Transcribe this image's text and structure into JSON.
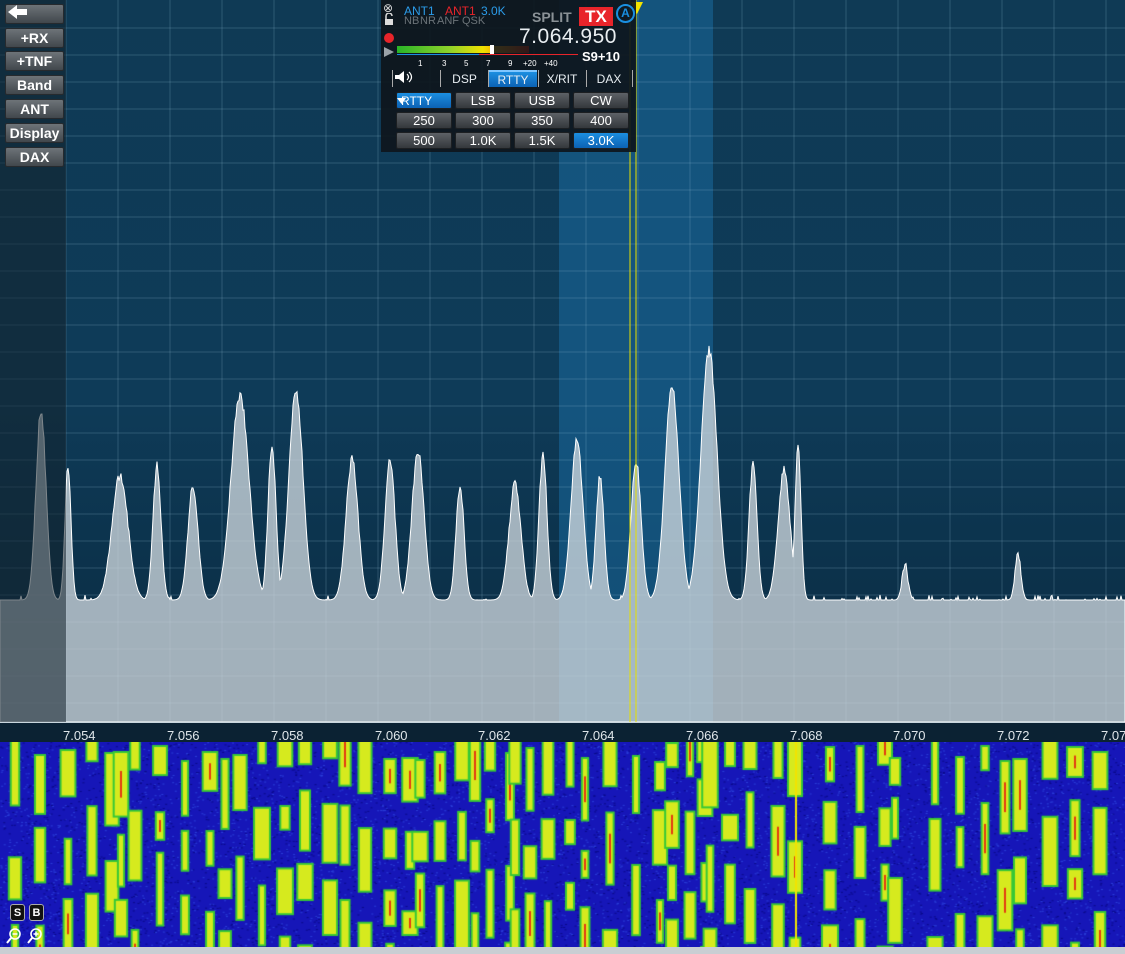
{
  "left_menu": {
    "back_icon": "arrow-left-icon",
    "buttons": [
      "+RX",
      "+TNF",
      "Band",
      "ANT",
      "Display",
      "DAX"
    ]
  },
  "slice": {
    "rx_ant": "ANT1",
    "tx_ant": "ANT1",
    "filter_width": "3.0K",
    "indicators": [
      "NB",
      "NR",
      "ANF",
      "QSK"
    ],
    "split_label": "SPLIT",
    "tx_label": "TX",
    "slice_letter": "A",
    "frequency": "7.064.950",
    "smeter_ticks": [
      "1",
      "3",
      "5",
      "7",
      "9",
      "+20",
      "+40"
    ],
    "smeter_reading": "S9+10",
    "smeter_level": 0.72,
    "tabs": [
      "DSP",
      "RTTY",
      "X/RIT",
      "DAX"
    ],
    "active_tab": "RTTY",
    "speaker_icon": "speaker-icon",
    "mode_select": "RTTY",
    "mode_buttons": [
      "LSB",
      "USB",
      "CW"
    ],
    "filter_buttons": [
      "250",
      "300",
      "350",
      "400",
      "500",
      "1.0K",
      "1.5K",
      "3.0K"
    ],
    "selected_filter": "3.0K"
  },
  "scale": {
    "ticks": [
      "7.054",
      "7.056",
      "7.058",
      "7.060",
      "7.062",
      "7.064",
      "7.066",
      "7.068",
      "7.070",
      "7.072",
      "7.07"
    ]
  },
  "waterfall": {
    "buttons": [
      "S",
      "B"
    ],
    "zoom_out_icon": "zoom-out-icon",
    "zoom_in_icon": "zoom-in-icon"
  },
  "colors": {
    "accent": "#1a8fe0",
    "tx_red": "#e8242a",
    "slice_marker": "#f2e400"
  }
}
